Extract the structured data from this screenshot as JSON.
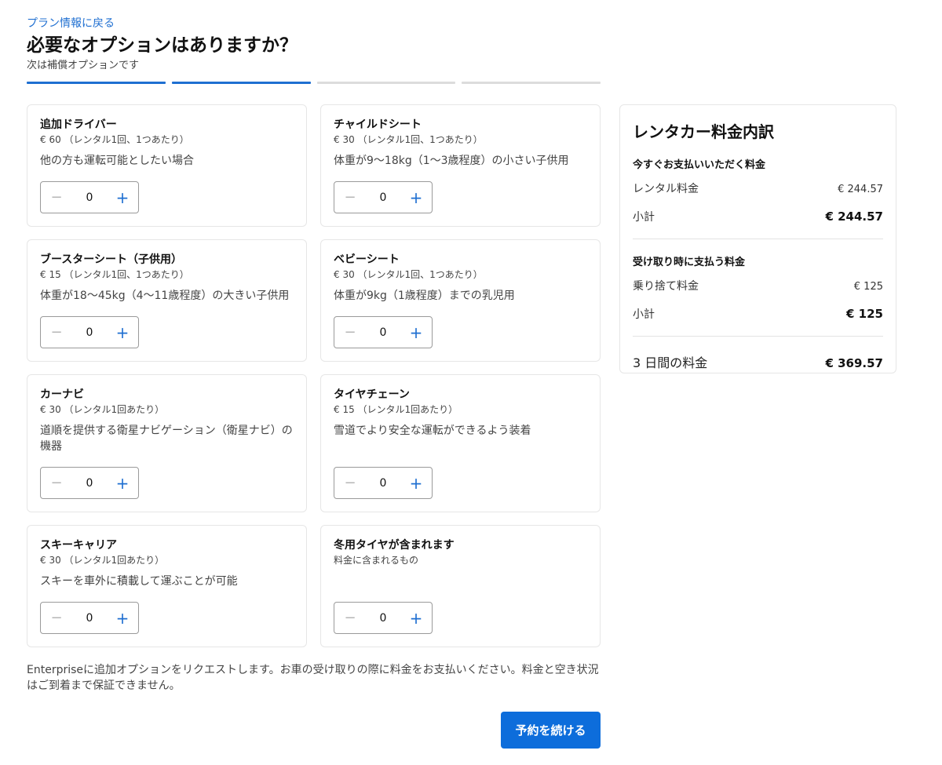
{
  "header": {
    "back_link": "プラン情報に戻る",
    "title": "必要なオプションはありますか？",
    "subtitle": "次は補償オプションです",
    "progress_steps": [
      true,
      true,
      false,
      false
    ]
  },
  "options": [
    {
      "title": "追加ドライバー",
      "price": "€ 60 （レンタル1回、1つあたり）",
      "desc": "他の方も運転可能としたい場合",
      "qty": "0",
      "minus": "−",
      "plus": "+"
    },
    {
      "title": "チャイルドシート",
      "price": "€ 30 （レンタル1回、1つあたり）",
      "desc": "体重が9〜18kg（1〜3歳程度）の小さい子供用",
      "qty": "0",
      "minus": "−",
      "plus": "+"
    },
    {
      "title": "ブースターシート（子供用）",
      "price": "€ 15 （レンタル1回、1つあたり）",
      "desc": "体重が18〜45kg（4〜11歳程度）の大きい子供用",
      "qty": "0",
      "minus": "−",
      "plus": "+"
    },
    {
      "title": "ベビーシート",
      "price": "€ 30 （レンタル1回、1つあたり）",
      "desc": "体重が9kg（1歳程度）までの乳児用",
      "qty": "0",
      "minus": "−",
      "plus": "+"
    },
    {
      "title": "カーナビ",
      "price": "€ 30 （レンタル1回あたり）",
      "desc": "道順を提供する衛星ナビゲーション（衛星ナビ）の機器",
      "qty": "0",
      "minus": "−",
      "plus": "+"
    },
    {
      "title": "タイヤチェーン",
      "price": "€ 15 （レンタル1回あたり）",
      "desc": "雪道でより安全な運転ができるよう装着",
      "qty": "0",
      "minus": "−",
      "plus": "+"
    },
    {
      "title": "スキーキャリア",
      "price": "€ 30 （レンタル1回あたり）",
      "desc": "スキーを車外に積載して運ぶことが可能",
      "qty": "0",
      "minus": "−",
      "plus": "+"
    },
    {
      "title": "冬用タイヤが含まれます",
      "price": "料金に含まれるもの",
      "desc": "",
      "qty": "0",
      "minus": "−",
      "plus": "+"
    }
  ],
  "disclaimer": "Enterpriseに追加オプションをリクエストします。お車の受け取りの際に料金をお支払いください。料金と空き状況はご到着まで保証できません。",
  "continue_button": "予約を続ける",
  "summary": {
    "title": "レンタカー料金内訳",
    "pay_now": {
      "title": "今すぐお支払いいただく料金",
      "rows": [
        {
          "label": "レンタル料金",
          "amount": "€ 244.57"
        }
      ],
      "subtotal_label": "小計",
      "subtotal_amount": "€ 244.57"
    },
    "pay_at_pickup": {
      "title": "受け取り時に支払う料金",
      "rows": [
        {
          "label": "乗り捨て料金",
          "amount": "€ 125"
        }
      ],
      "subtotal_label": "小計",
      "subtotal_amount": "€ 125"
    },
    "total_label": "3 日間の料金",
    "total_amount": "€ 369.57"
  },
  "colors": {
    "accent": "#1f6fd1",
    "button": "#0d6ddb"
  }
}
